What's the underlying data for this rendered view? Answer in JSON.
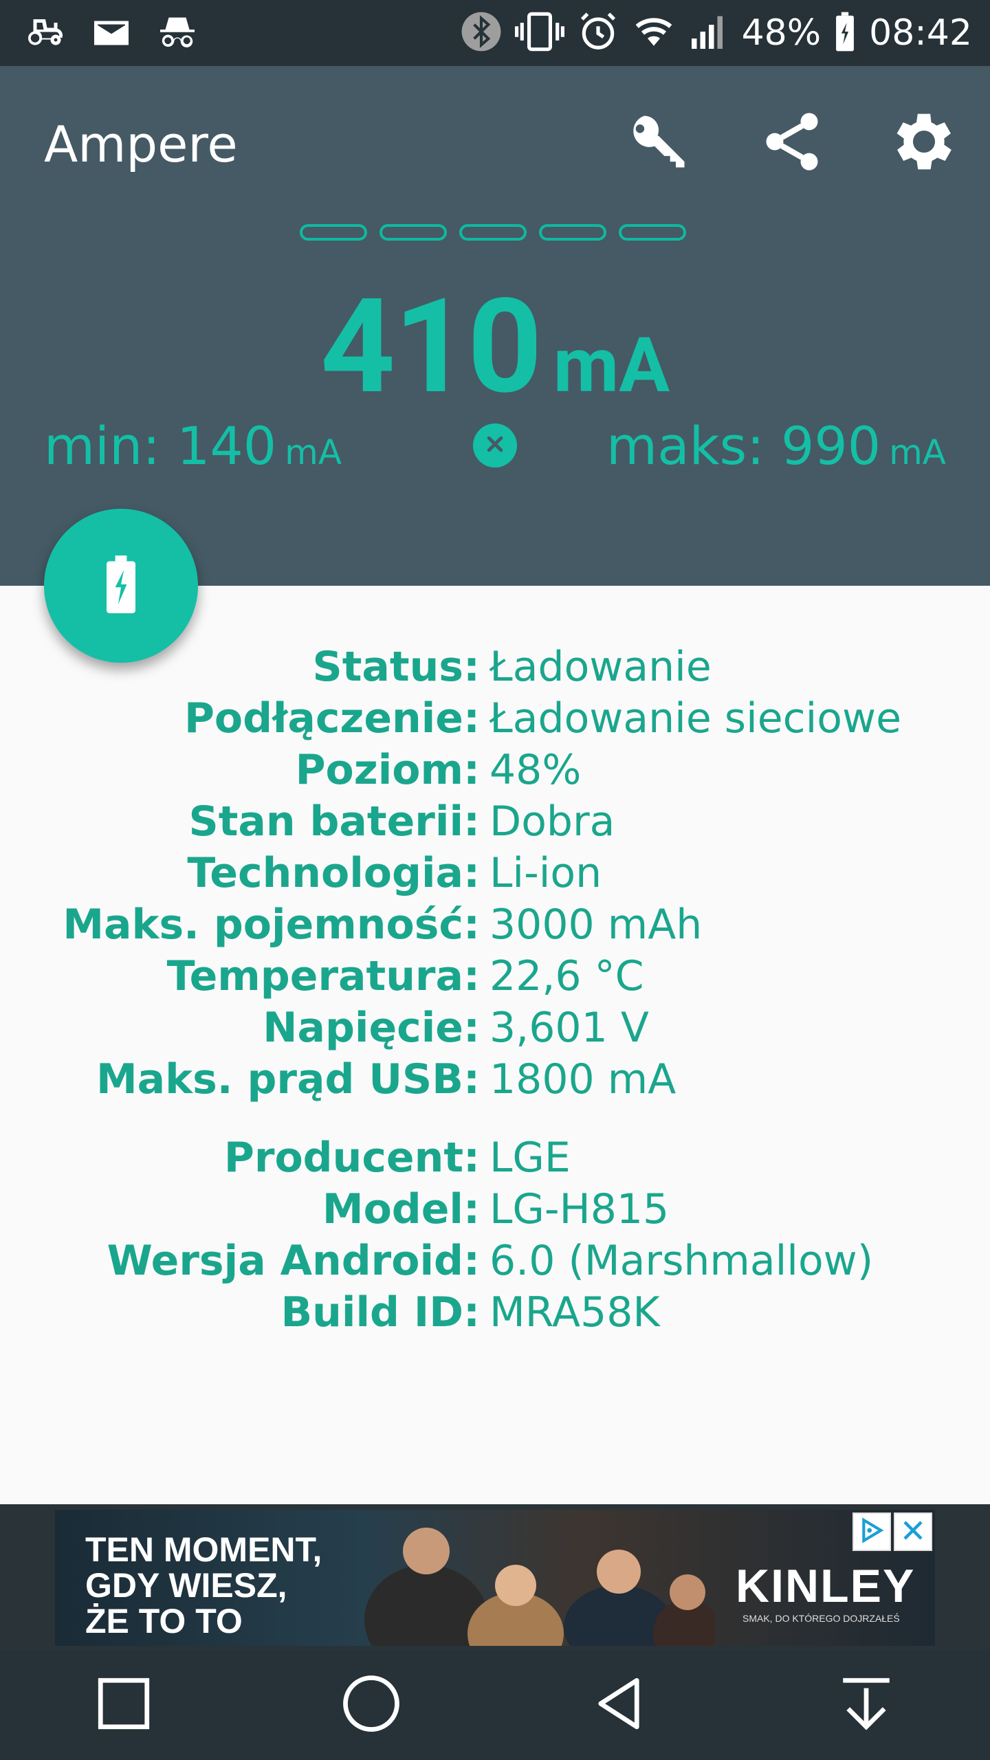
{
  "status_bar": {
    "battery_percent": "48%",
    "time": "08:42",
    "left_icons": [
      "tractor-icon",
      "mail-icon",
      "incognito-icon"
    ],
    "right_icons": [
      "bluetooth-icon",
      "vibrate-icon",
      "alarm-icon",
      "wifi-icon",
      "signal-icon",
      "battery-charging-icon"
    ]
  },
  "app_bar": {
    "title": "Ampere",
    "actions": [
      "key-icon",
      "share-icon",
      "settings-icon"
    ]
  },
  "meter": {
    "value": "410",
    "unit": "mA",
    "segments_total": 5,
    "min_label": "min: 140",
    "min_unit": "mA",
    "max_label": "maks: 990",
    "max_unit": "mA"
  },
  "battery_info": [
    {
      "key": "Status:",
      "value": "Ładowanie"
    },
    {
      "key": "Podłączenie:",
      "value": "Ładowanie sieciowe"
    },
    {
      "key": "Poziom:",
      "value": "48%"
    },
    {
      "key": "Stan baterii:",
      "value": "Dobra"
    },
    {
      "key": "Technologia:",
      "value": "Li-ion"
    },
    {
      "key": "Maks. pojemność:",
      "value": "3000 mAh"
    },
    {
      "key": "Temperatura:",
      "value": "22,6 °C"
    },
    {
      "key": "Napięcie:",
      "value": "3,601 V"
    },
    {
      "key": "Maks. prąd USB:",
      "value": "1800 mA"
    }
  ],
  "device_info": [
    {
      "key": "Producent:",
      "value": "LGE"
    },
    {
      "key": "Model:",
      "value": "LG-H815"
    },
    {
      "key": "Wersja Android:",
      "value": "6.0 (Marshmallow)"
    },
    {
      "key": "Build ID:",
      "value": "MRA58K"
    }
  ],
  "ad": {
    "line1": "TEN MOMENT,",
    "line2": "GDY WIESZ,",
    "line3": "ŻE TO TO",
    "brand": "KINLEY",
    "tagline": "SMAK, DO KTÓREGO DOJRZAŁEŚ"
  },
  "nav": [
    "recents-button",
    "home-button",
    "back-button",
    "notification-pulldown-button"
  ],
  "colors": {
    "accent": "#14bfa6",
    "header": "#455a64",
    "status_bar": "#263238",
    "background": "#fafafa"
  }
}
